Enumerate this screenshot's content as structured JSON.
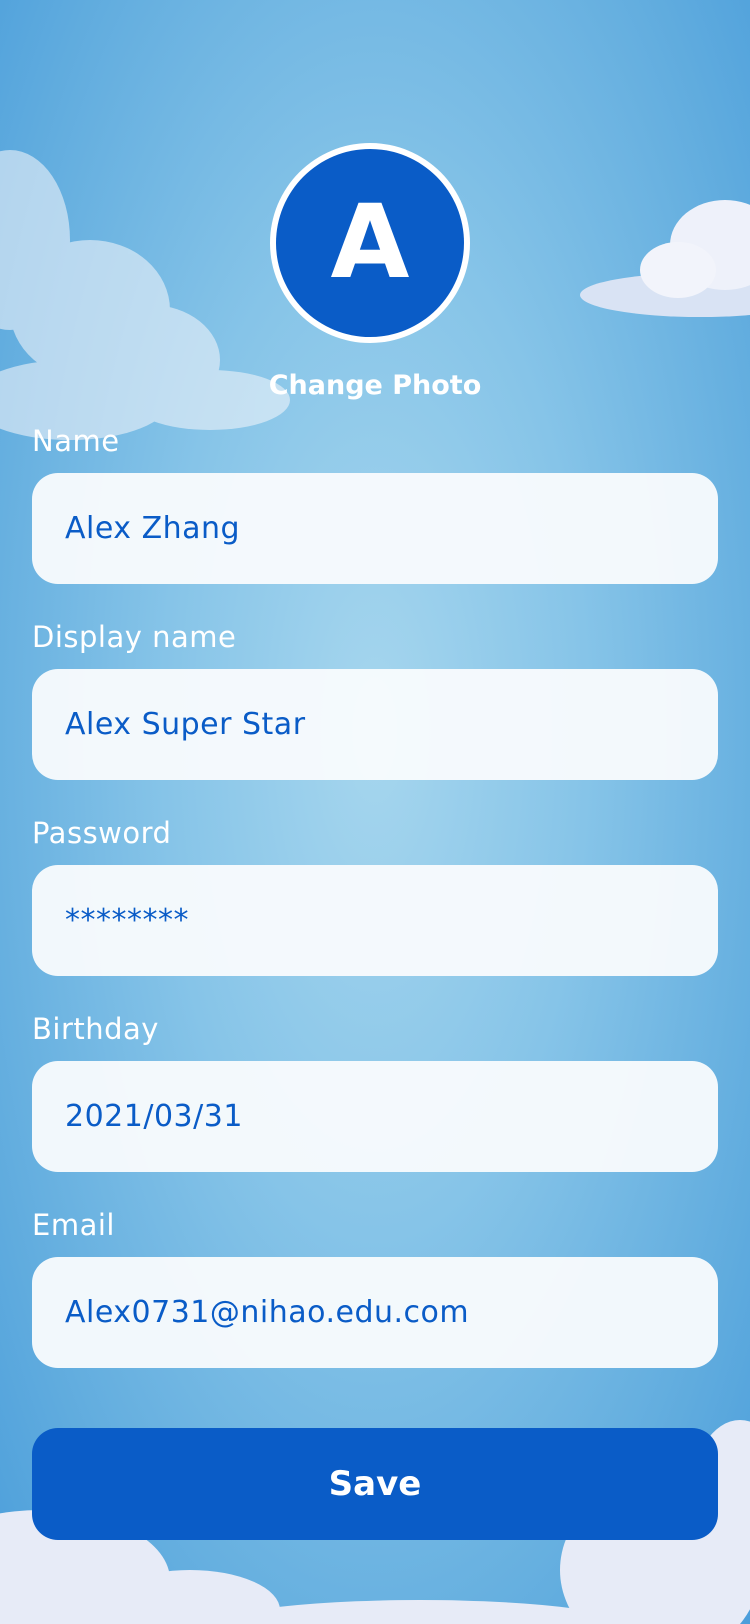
{
  "avatar": {
    "initial": "A",
    "change_photo_label": "Change Photo"
  },
  "form": {
    "name": {
      "label": "Name",
      "value": "Alex Zhang"
    },
    "display_name": {
      "label": "Display name",
      "value": "Alex Super Star"
    },
    "password": {
      "label": "Password",
      "value": "********"
    },
    "birthday": {
      "label": "Birthday",
      "value": "2021/03/31"
    },
    "email": {
      "label": "Email",
      "value": "Alex0731@nihao.edu.com"
    }
  },
  "actions": {
    "save_label": "Save"
  },
  "colors": {
    "accent": "#0a5cc7",
    "field_background": "#f6fafd",
    "sky_light": "#a6d6ee",
    "sky_dark": "#4b9edb"
  }
}
